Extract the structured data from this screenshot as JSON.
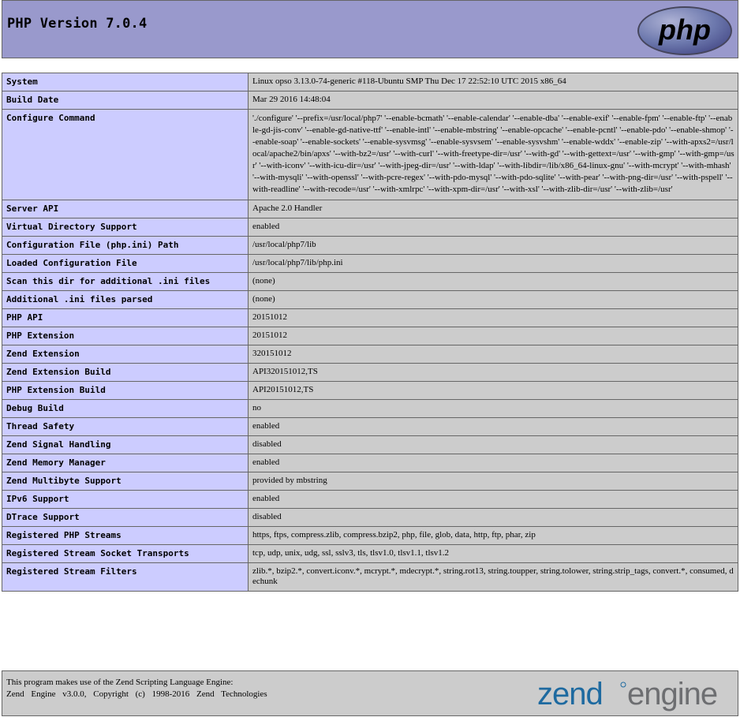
{
  "header": {
    "title": "PHP Version 7.0.4",
    "logo_text": "php"
  },
  "rows": [
    {
      "label": "System",
      "value": "Linux opso 3.13.0-74-generic #118-Ubuntu SMP Thu Dec 17 22:52:10 UTC 2015 x86_64"
    },
    {
      "label": "Build Date",
      "value": "Mar 29 2016 14:48:04"
    },
    {
      "label": "Configure Command",
      "value": "'./configure' '--prefix=/usr/local/php7' '--enable-bcmath' '--enable-calendar' '--enable-dba' '--enable-exif' '--enable-fpm' '--enable-ftp' '--enable-gd-jis-conv' '--enable-gd-native-ttf' '--enable-intl' '--enable-mbstring' '--enable-opcache' '--enable-pcntl' '--enable-pdo' '--enable-shmop' '--enable-soap' '--enable-sockets' '--enable-sysvmsg' '--enable-sysvsem' '--enable-sysvshm' '--enable-wddx' '--enable-zip' '--with-apxs2=/usr/local/apache2/bin/apxs' '--with-bz2=/usr' '--with-curl' '--with-freetype-dir=/usr' '--with-gd' '--with-gettext=/usr' '--with-gmp' '--with-gmp=/usr' '--with-iconv' '--with-icu-dir=/usr' '--with-jpeg-dir=/usr' '--with-ldap' '--with-libdir=/lib/x86_64-linux-gnu' '--with-mcrypt' '--with-mhash' '--with-mysqli' '--with-openssl' '--with-pcre-regex' '--with-pdo-mysql' '--with-pdo-sqlite' '--with-pear' '--with-png-dir=/usr' '--with-pspell' '--with-readline' '--with-recode=/usr' '--with-xmlrpc' '--with-xpm-dir=/usr' '--with-xsl' '--with-zlib-dir=/usr' '--with-zlib=/usr'"
    },
    {
      "label": "Server API",
      "value": "Apache 2.0 Handler"
    },
    {
      "label": "Virtual Directory Support",
      "value": "enabled"
    },
    {
      "label": "Configuration File (php.ini) Path",
      "value": "/usr/local/php7/lib"
    },
    {
      "label": "Loaded Configuration File",
      "value": "/usr/local/php7/lib/php.ini"
    },
    {
      "label": "Scan this dir for additional .ini files",
      "value": "(none)"
    },
    {
      "label": "Additional .ini files parsed",
      "value": "(none)"
    },
    {
      "label": "PHP API",
      "value": "20151012"
    },
    {
      "label": "PHP Extension",
      "value": "20151012"
    },
    {
      "label": "Zend Extension",
      "value": "320151012"
    },
    {
      "label": "Zend Extension Build",
      "value": "API320151012,TS"
    },
    {
      "label": "PHP Extension Build",
      "value": "API20151012,TS"
    },
    {
      "label": "Debug Build",
      "value": "no"
    },
    {
      "label": "Thread Safety",
      "value": "enabled"
    },
    {
      "label": "Zend Signal Handling",
      "value": "disabled"
    },
    {
      "label": "Zend Memory Manager",
      "value": "enabled"
    },
    {
      "label": "Zend Multibyte Support",
      "value": "provided by mbstring"
    },
    {
      "label": "IPv6 Support",
      "value": "enabled"
    },
    {
      "label": "DTrace Support",
      "value": "disabled"
    },
    {
      "label": "Registered PHP Streams",
      "value": "https, ftps, compress.zlib, compress.bzip2, php, file, glob, data, http, ftp, phar, zip"
    },
    {
      "label": "Registered Stream Socket Transports",
      "value": "tcp, udp, unix, udg, ssl, sslv3, tls, tlsv1.0, tlsv1.1, tlsv1.2"
    },
    {
      "label": "Registered Stream Filters",
      "value": "zlib.*, bzip2.*, convert.iconv.*, mcrypt.*, mdecrypt.*, string.rot13, string.toupper, string.tolower, string.strip_tags, convert.*, consumed, dechunk"
    }
  ],
  "footer": {
    "line1": "This program makes use of the Zend Scripting Language Engine:",
    "line2": "Zend Engine v3.0.0, Copyright (c) 1998-2016 Zend Technologies",
    "logo_zend": "zend",
    "logo_engine": "engine"
  },
  "colors": {
    "header_bg": "#9999cc",
    "label_bg": "#ccccff",
    "value_bg": "#cccccc",
    "border": "#666666",
    "zend_blue": "#1e6aa0",
    "zend_gray": "#6d6e71"
  }
}
